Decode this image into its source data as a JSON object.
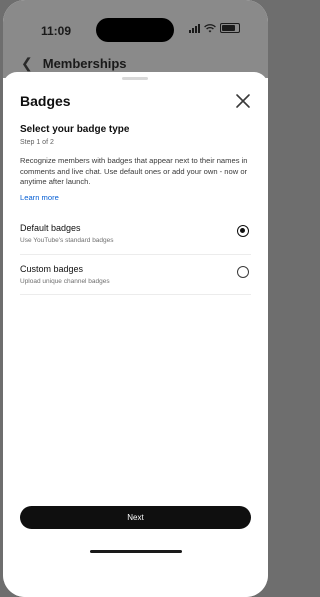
{
  "status_bar": {
    "time": "11:09"
  },
  "header": {
    "title": "Memberships"
  },
  "sheet": {
    "title": "Badges",
    "heading": "Select your badge type",
    "step": "Step 1 of 2",
    "description": "Recognize members with badges that appear next to their names in comments and live chat. Use default ones or add your own - now or anytime after launch.",
    "learn_more": "Learn more",
    "options": [
      {
        "title": "Default badges",
        "subtitle": "Use YouTube's standard badges",
        "selected": true
      },
      {
        "title": "Custom badges",
        "subtitle": "Upload unique channel badges",
        "selected": false
      }
    ],
    "next_label": "Next"
  },
  "colors": {
    "accent_link": "#065fd4",
    "primary_button": "#0f0f0f"
  },
  "icons": [
    "back-chevron-icon",
    "close-icon",
    "signal-icon",
    "wifi-icon",
    "battery-icon"
  ]
}
